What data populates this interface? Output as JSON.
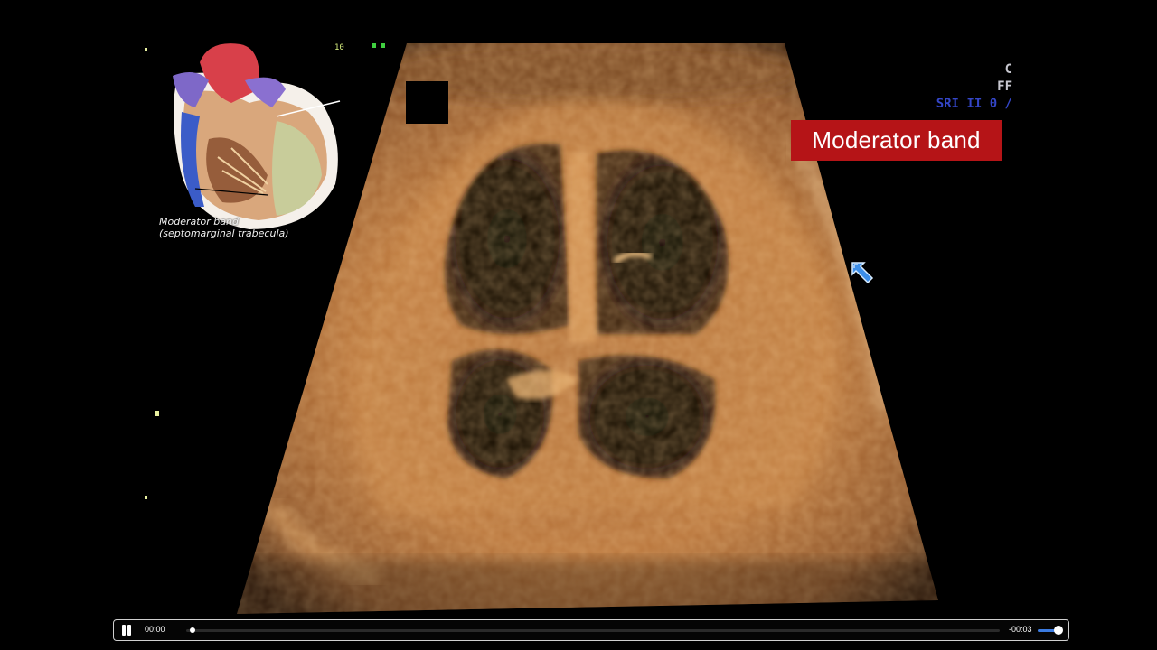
{
  "overlay": {
    "label": "Moderator band",
    "label_color": "#b51417",
    "heart_caption_line1": "Moderator band",
    "heart_caption_line2": "(septomarginal trabecula)"
  },
  "screen_text": {
    "line1": "C",
    "line2": "FF",
    "line3": "SRI II 0 /",
    "top_marks": "10"
  },
  "player": {
    "state": "playing",
    "current_time": "00:00",
    "remaining_time": "-00:03",
    "progress": 0.0,
    "volume": 0.9,
    "accent_color": "#3b7be0"
  },
  "icons": {
    "pause": "pause-icon",
    "cursor": "arrow-cursor-icon"
  }
}
